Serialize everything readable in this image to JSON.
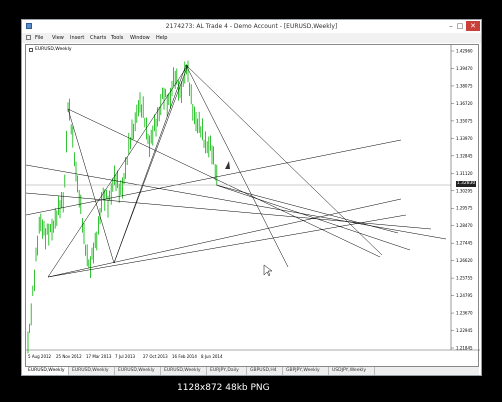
{
  "window": {
    "title": "2174273: AL Trade 4 - Demo Account - [EURUSD,Weekly]"
  },
  "menu": [
    "File",
    "View",
    "Insert",
    "Charts",
    "Tools",
    "Window",
    "Help"
  ],
  "chart": {
    "label": "EURUSD,Weekly",
    "current_price": "1.32830",
    "price_ticks": [
      "1.42960",
      "1.39470",
      "1.38075",
      "1.36720",
      "1.35075",
      "1.33970",
      "1.32845",
      "1.31120",
      "1.30295",
      "1.29575",
      "1.28470",
      "1.27445",
      "1.26620",
      "1.25755",
      "1.24795",
      "1.23670",
      "1.22945",
      "1.21845"
    ],
    "date_ticks": [
      "5 Aug 2012",
      "25 Nov 2012",
      "17 Mar 2013",
      "7 Jul 2013",
      "27 Oct 2013",
      "16 Feb 2014",
      "8 Jun 2014"
    ]
  },
  "tabs": [
    "EURUSD,Weekly",
    "EURUSD,Weekly",
    "EURUSD,Weekly",
    "EURUSD,Weekly",
    "EURJPY,Daily",
    "GBPUSD,H4",
    "GBPJPY,Weekly",
    "USDJPY,Weekly"
  ],
  "status": "1128x872  48kb  PNG",
  "colors": {
    "candles": "#00b400",
    "lines": "#000000",
    "close": "#c7413a"
  }
}
